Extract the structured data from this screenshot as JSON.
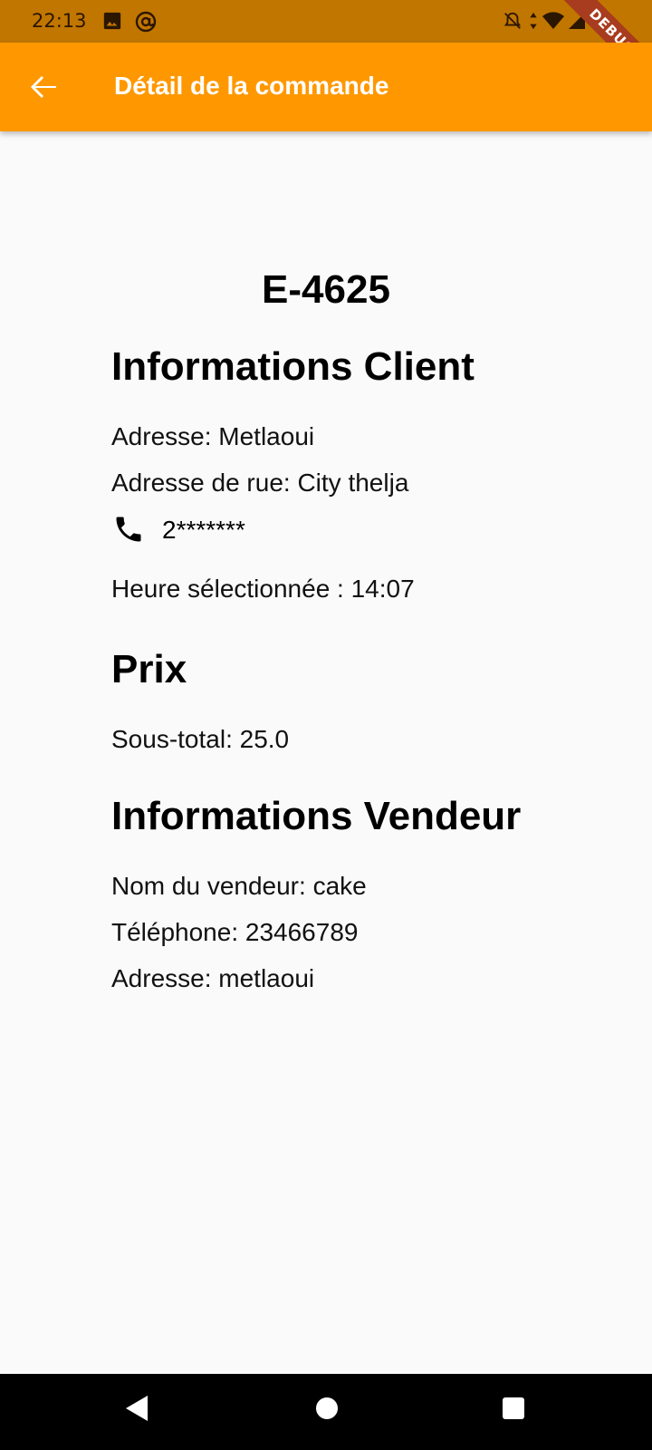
{
  "status_bar": {
    "time": "22:13"
  },
  "debug_banner": "DEBUG",
  "app_bar": {
    "title": "Détail de la commande"
  },
  "order": {
    "id": "E-4625"
  },
  "client": {
    "section_title": "Informations Client",
    "address": "Adresse: Metlaoui",
    "street": "Adresse de rue: City thelja",
    "phone": "2*******",
    "selected_time": "Heure sélectionnée : 14:07"
  },
  "price": {
    "section_title": "Prix",
    "subtotal": "Sous-total: 25.0"
  },
  "vendor": {
    "section_title": "Informations Vendeur",
    "name": "Nom du vendeur: cake",
    "phone": "Téléphone: 23466789",
    "address": "Adresse: metlaoui"
  },
  "colors": {
    "app_bar": "#ff9800",
    "status_bar": "#c17600",
    "background": "#fafafa",
    "debug_ribbon": "#a83c1e"
  },
  "icons": {
    "back": "arrow-back-icon",
    "phone": "phone-icon",
    "nav_back": "triangle-back-icon",
    "nav_home": "circle-home-icon",
    "nav_recents": "square-recents-icon"
  }
}
